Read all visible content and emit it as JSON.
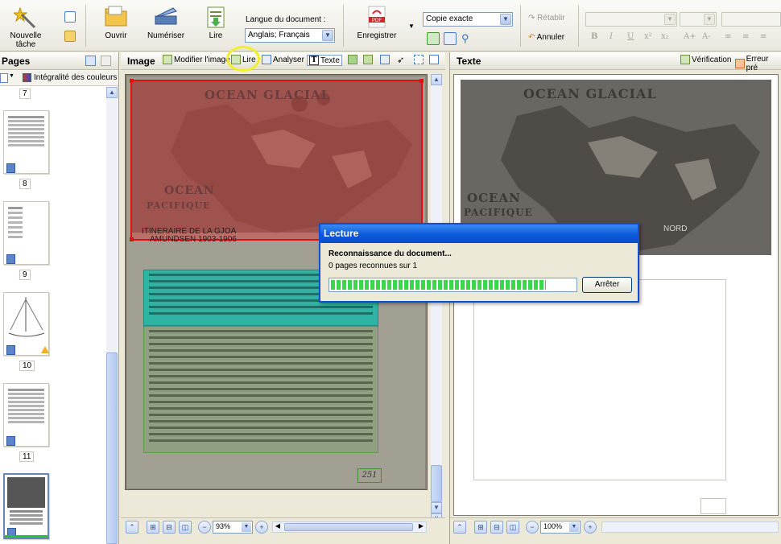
{
  "toolbar": {
    "new_task_label": "Nouvelle tâche",
    "open_label": "Ouvrir",
    "scan_label": "Numériser",
    "read_label": "Lire",
    "language_label": "Langue du document :",
    "language_value": "Anglais; Français",
    "save_label": "Enregistrer",
    "save_mode_value": "Copie exacte",
    "redo_label": "Rétablir",
    "undo_label": "Annuler",
    "format_buttons": [
      "B",
      "I",
      "U",
      "x²",
      "x₂",
      "A+",
      "A-"
    ]
  },
  "pages_panel": {
    "title": "Pages",
    "color_mode": "Intégralité des couleurs",
    "page_numbers": [
      "7",
      "8",
      "9",
      "10",
      "11"
    ]
  },
  "image_panel": {
    "title": "Image",
    "edit_image_label": "Modifier l'image",
    "read_label": "Lire",
    "analyze_label": "Analyser",
    "text_label": "Texte",
    "map_title_1": "OCEAN GLACIAL",
    "map_title_2": "OCEAN",
    "map_title_3": "PACIFIQUE",
    "caption_line1": "ITINERAIRE DE LA GJOA",
    "caption_line2": "AMUNDSEN 1903-1906",
    "page_number": "251",
    "zoom": "93%"
  },
  "text_panel": {
    "title": "Texte",
    "verification_label": "Vérification",
    "error_label": "Erreur pré",
    "map_title_1": "OCEAN GLACIAL",
    "map_title_2": "OCEAN",
    "map_title_3": "PACIFIQUE",
    "map_north": "NORD",
    "zoom": "100%"
  },
  "dialog": {
    "title": "Lecture",
    "status": "Reconnaissance du document...",
    "count": "0 pages reconnues sur 1",
    "progress": 0.88,
    "stop_label": "Arrêter"
  },
  "colors": {
    "red_zone": "#e01010",
    "teal_zone": "#2fb3a3",
    "green_zone": "#5a9a4a",
    "highlight": "#f1ef2a",
    "title_bar": "#0b5ad9"
  }
}
